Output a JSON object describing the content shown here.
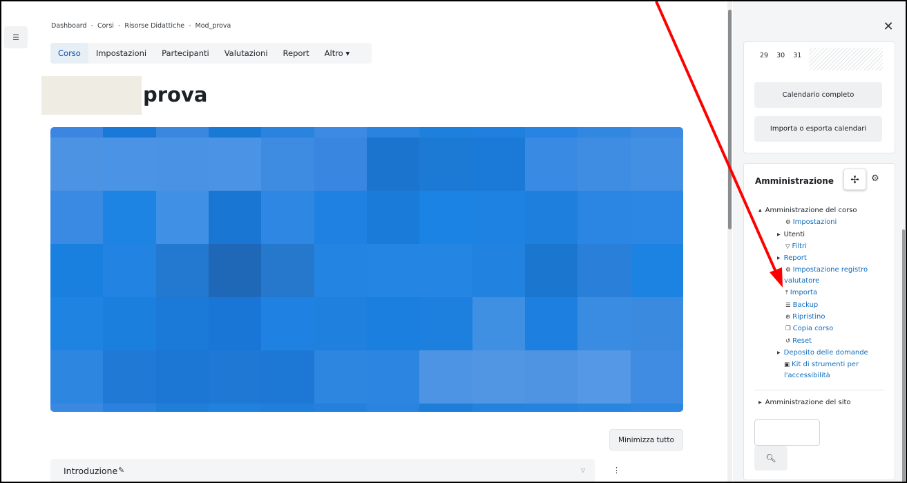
{
  "breadcrumb": [
    "Dashboard",
    "Corsi",
    "Risorse Didattiche",
    "Mod_prova"
  ],
  "breadcrumb_separator": "-",
  "nav_tabs": [
    {
      "label": "Corso",
      "active": true
    },
    {
      "label": "Impostazioni",
      "active": false
    },
    {
      "label": "Partecipanti",
      "active": false
    },
    {
      "label": "Valutazioni",
      "active": false
    },
    {
      "label": "Report",
      "active": false
    },
    {
      "label": "Altro ▾",
      "active": false
    }
  ],
  "page_title": "prova",
  "course_image_colors": [
    [
      "#3c86e2",
      "#1a78d8",
      "#3a87e0",
      "#197ad6",
      "#2b83e0",
      "#3c8ae2",
      "#2b83e0",
      "#1d80dd",
      "#1f80e0",
      "#2784e2",
      "#3287e0",
      "#3c8ae2"
    ],
    [
      "#4c93e4",
      "#4b93e4",
      "#4a92e3",
      "#4b93e4",
      "#3e8ce2",
      "#3986e0",
      "#1b75cf",
      "#1c79d4",
      "#1b7ad7",
      "#388ae2",
      "#3f8de3",
      "#428fe3"
    ],
    [
      "#3a8ae3",
      "#1e84e4",
      "#4091e5",
      "#1977d3",
      "#2f87e4",
      "#1f82e3",
      "#1a7bd9",
      "#1b83e3",
      "#1d82e2",
      "#1e7fdc",
      "#2b86e3",
      "#2c87e4"
    ],
    [
      "#1a80e0",
      "#2283e2",
      "#2378d0",
      "#1f68b8",
      "#2678cc",
      "#2484e2",
      "#2585e2",
      "#2585e2",
      "#2182e0",
      "#1b76cf",
      "#2a80d9",
      "#1d83e3"
    ],
    [
      "#1f83e2",
      "#1b7fde",
      "#1b7ad8",
      "#1976d6",
      "#1f82e2",
      "#1f80de",
      "#1a7fde",
      "#1d80de",
      "#3f8fe3",
      "#1d80e0",
      "#3a8be2",
      "#3a8ae0"
    ],
    [
      "#2d86e0",
      "#2079d4",
      "#1b76d4",
      "#1f78d4",
      "#1d78d5",
      "#2d86e0",
      "#2c85e0",
      "#4e94e4",
      "#5196e3",
      "#4f94e2",
      "#5598e5",
      "#3f8ce2"
    ],
    [
      "#3a88e0",
      "#2a82de",
      "#1f7ed8",
      "#2182dd",
      "#1f7fdb",
      "#2580dc",
      "#2a83de",
      "#1c7ed9",
      "#2282de",
      "#2483de",
      "#2a85e0",
      "#2d86e0"
    ]
  ],
  "collapse_all_label": "Minimizza tutto",
  "section": {
    "name": "Introduzione"
  },
  "calendar": {
    "days": [
      "29",
      "30",
      "31"
    ],
    "full_calendar_label": "Calendario completo",
    "import_export_label": "Importa o esporta calendari"
  },
  "admin": {
    "title": "Amministrazione",
    "course_admin": "Amministrazione del corso",
    "items": [
      {
        "label": "Impostazioni",
        "icon": "gear-icon",
        "kind": "link"
      },
      {
        "label": "Utenti",
        "icon": "triangle-icon",
        "kind": "plain"
      },
      {
        "label": "Filtri",
        "icon": "filter-icon",
        "kind": "link"
      },
      {
        "label": "Report",
        "icon": "triangle-icon",
        "kind": "link"
      },
      {
        "label": "Impostazione registro",
        "icon": "gear-icon",
        "kind": "link"
      },
      {
        "label": "valutatore",
        "icon": "",
        "kind": "link"
      },
      {
        "label": "Importa",
        "icon": "upload-icon",
        "kind": "link"
      },
      {
        "label": "Backup",
        "icon": "database-icon",
        "kind": "link"
      },
      {
        "label": "Ripristino",
        "icon": "restore-icon",
        "kind": "link"
      },
      {
        "label": "Copia corso",
        "icon": "copy-icon",
        "kind": "link"
      },
      {
        "label": "Reset",
        "icon": "reset-icon",
        "kind": "link"
      },
      {
        "label": "Deposito delle domande",
        "icon": "triangle-icon",
        "kind": "link"
      },
      {
        "label": "Kit di strumenti per",
        "icon": "accessibility-icon",
        "kind": "link"
      },
      {
        "label": "l'accessibilità",
        "icon": "",
        "kind": "link"
      }
    ],
    "site_admin": "Amministrazione del sito"
  },
  "colors": {
    "link": "#0f6cbf",
    "active_tab": "#0f47ad",
    "annotation_arrow": "#ff0000"
  }
}
